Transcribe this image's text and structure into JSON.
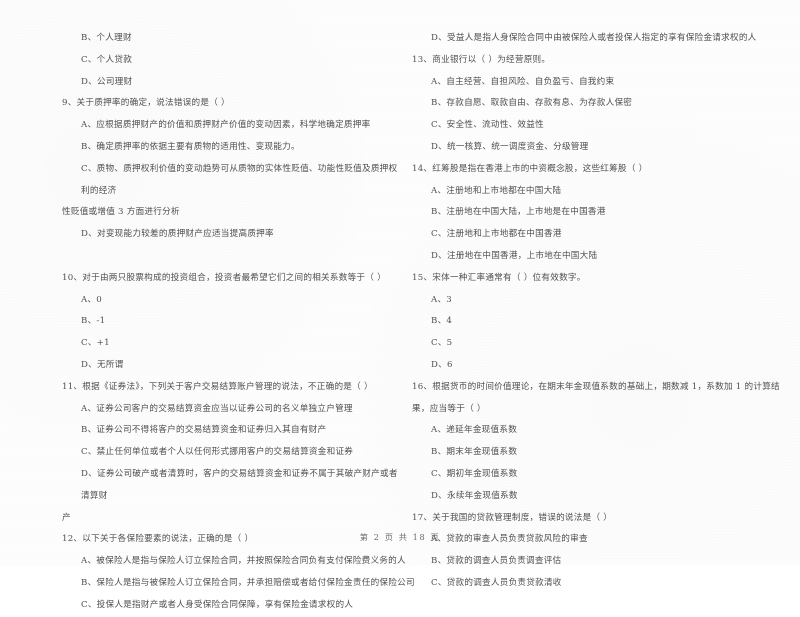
{
  "document": {
    "footer": "第 2 页 共 18 页",
    "page_number": "2",
    "total_pages": "18"
  },
  "left_column": {
    "leading_options": [
      {
        "label": "B、个人理财"
      },
      {
        "label": "C、个人贷款"
      },
      {
        "label": "D、公司理财"
      }
    ],
    "questions": [
      {
        "number": "9",
        "stem": "9、关于质押率的确定，说法错误的是（        ）",
        "options": [
          {
            "text": "A、应根据质押财产的价值和质押财产价值的变动因素，科学地确定质押率"
          },
          {
            "text": "B、确定质押率的依据主要有质物的适用性、变现能力。"
          },
          {
            "text": "C、质物、质押权利价值的变动趋势可从质物的实体性贬值、功能性贬值及质押权利的经济",
            "overflow": "性贬值或增值 3 方面进行分析"
          },
          {
            "text": "D、对变现能力较差的质押财产应适当提高质押率"
          }
        ]
      },
      {
        "number": "10",
        "stem": "10、对于由两只股票构成的投资组合，投资者最希望它们之间的相关系数等于（        ）",
        "options": [
          {
            "text": "A、0"
          },
          {
            "text": "B、-1"
          },
          {
            "text": "C、+1"
          },
          {
            "text": "D、无所谓"
          }
        ]
      },
      {
        "number": "11",
        "stem": "11、根据《证券法》，下列关于客户交易结算账户管理的说法，不正确的是（        ）",
        "options": [
          {
            "text": "A、证券公司客户的交易结算资金应当以证券公司的名义单独立户管理"
          },
          {
            "text": "B、证券公司不得将客户的交易结算资金和证券归入其自有财产"
          },
          {
            "text": "C、禁止任何单位或者个人以任何形式挪用客户的交易结算资金和证券"
          },
          {
            "text": "D、证券公司破产或者清算时，客户的交易结算资金和证券不属于其破产财产或者清算财",
            "overflow": "产"
          }
        ]
      },
      {
        "number": "12",
        "stem": "12、以下关于各保险要素的说法，正确的是（        ）",
        "options": [
          {
            "text": "A、被保险人是指与保险人订立保险合同，并按照保险合同负有支付保险费义务的人"
          },
          {
            "text": "B、保险人是指与被保险人订立保险合同，并承担赔偿或者给付保险金责任的保险公司"
          },
          {
            "text": "C、投保人是指财产或者人身受保险合同保障，享有保险金请求权的人"
          }
        ]
      }
    ]
  },
  "right_column": {
    "leading_options": [
      {
        "label": "D、受益人是指人身保险合同中由被保险人或者投保人指定的享有保险金请求权的人"
      }
    ],
    "questions": [
      {
        "number": "13",
        "stem": "13、商业银行以（        ）为经营原则。",
        "options": [
          {
            "text": "A、自主经营、自担风险、自负盈亏、自我约束"
          },
          {
            "text": "B、存款自愿、取款自由、存款有息、为存款人保密"
          },
          {
            "text": "C、安全性、流动性、效益性"
          },
          {
            "text": "D、统一核算、统一调度资金、分级管理"
          }
        ]
      },
      {
        "number": "14",
        "stem": "14、红筹股是指在香港上市的中资概念股，这些红筹股（        ）",
        "options": [
          {
            "text": "A、注册地和上市地都在中国大陆"
          },
          {
            "text": "B、注册地在中国大陆，上市地是在中国香港"
          },
          {
            "text": "C、注册地和上市地都在中国香港"
          },
          {
            "text": "D、注册地在中国香港，上市地在中国大陆"
          }
        ]
      },
      {
        "number": "15",
        "stem": "15、宋体一种汇率通常有（        ）位有效数字。",
        "options": [
          {
            "text": "A、3"
          },
          {
            "text": "B、4"
          },
          {
            "text": "C、5"
          },
          {
            "text": "D、6"
          }
        ]
      },
      {
        "number": "16",
        "stem": "16、根据货币的时间价值理论，在期末年金现值系数的基础上，期数减 1，系数加 1 的计算结",
        "stem_overflow": "果，应当等于（        ）",
        "options": [
          {
            "text": "A、递延年金现值系数"
          },
          {
            "text": "B、期末年金现值系数"
          },
          {
            "text": "C、期初年金现值系数"
          },
          {
            "text": "D、永续年金现值系数"
          }
        ]
      },
      {
        "number": "17",
        "stem": "17、关于我国的贷款管理制度，错误的说法是（        ）",
        "options": [
          {
            "text": "A、贷款的审查人员负责贷款风险的审查"
          },
          {
            "text": "B、贷款的调查人员负责调查评估"
          },
          {
            "text": "C、贷款的调查人员负责贷款清收"
          }
        ]
      }
    ]
  }
}
